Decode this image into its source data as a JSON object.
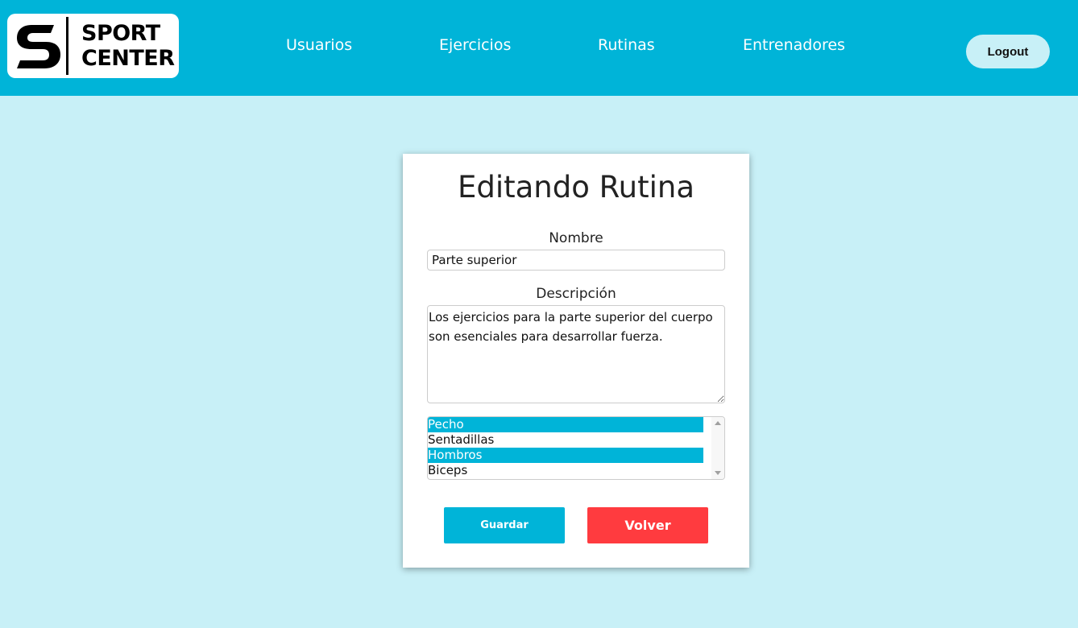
{
  "logo": {
    "line1": "SPORT",
    "line2": "CENTER",
    "icon": "s-letter-logo-icon"
  },
  "nav": {
    "items": [
      {
        "label": "Usuarios"
      },
      {
        "label": "Ejercicios"
      },
      {
        "label": "Rutinas"
      },
      {
        "label": "Entrenadores"
      }
    ],
    "logout_label": "Logout"
  },
  "form": {
    "title": "Editando Rutina",
    "nombre_label": "Nombre",
    "nombre_value": "Parte superior",
    "descripcion_label": "Descripción",
    "descripcion_value": "Los ejercicios para la parte superior del cuerpo son esenciales para desarrollar fuerza.",
    "ejercicios": [
      {
        "label": "Pecho",
        "selected": true
      },
      {
        "label": "Sentadillas",
        "selected": false
      },
      {
        "label": "Hombros",
        "selected": true
      },
      {
        "label": "Biceps",
        "selected": false
      }
    ],
    "save_label": "Guardar",
    "back_label": "Volver"
  },
  "colors": {
    "accent": "#00b4d8",
    "background": "#c8f0f7",
    "danger": "#ff3b3f"
  }
}
